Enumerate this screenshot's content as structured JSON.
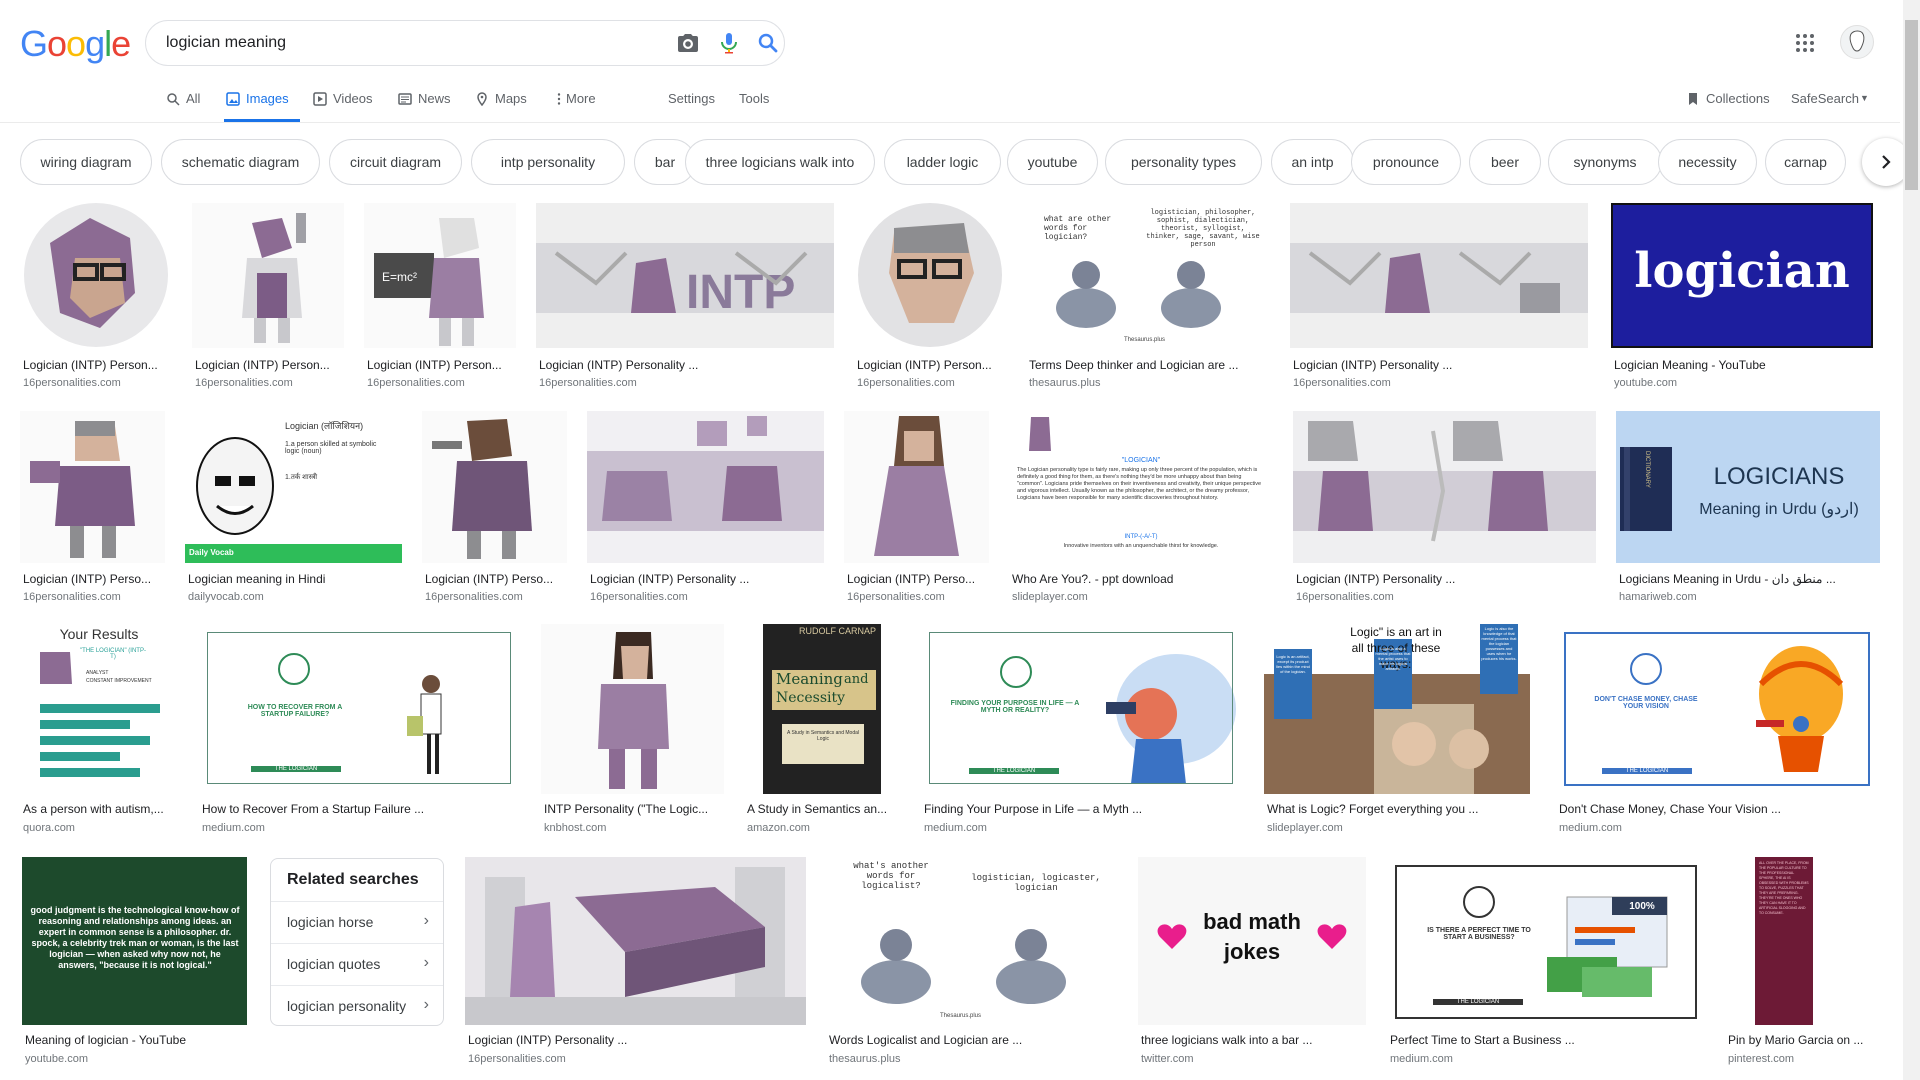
{
  "search": {
    "query": "logician meaning"
  },
  "logo": {
    "letters": [
      "G",
      "o",
      "o",
      "g",
      "l",
      "e"
    ],
    "colors": [
      "#4285F4",
      "#EA4335",
      "#FBBC05",
      "#4285F4",
      "#34A853",
      "#EA4335"
    ]
  },
  "tabs": {
    "all": "All",
    "images": "Images",
    "videos": "Videos",
    "news": "News",
    "maps": "Maps",
    "more": "More",
    "settings": "Settings",
    "tools": "Tools",
    "collections": "Collections",
    "safesearch": "SafeSearch"
  },
  "accent": "#1a73e8",
  "chips": [
    "wiring diagram",
    "schematic diagram",
    "circuit diagram",
    "intp personality",
    "bar",
    "three logicians walk into",
    "ladder logic",
    "youtube",
    "personality types",
    "an intp",
    "pronounce",
    "beer",
    "synonyms",
    "necessity",
    "carnap"
  ],
  "results": {
    "r1": [
      {
        "title": "Logician (INTP) Person...",
        "domain": "16personalities.com"
      },
      {
        "title": "Logician (INTP) Person...",
        "domain": "16personalities.com"
      },
      {
        "title": "Logician (INTP) Person...",
        "domain": "16personalities.com"
      },
      {
        "title": "Logician (INTP) Personality ...",
        "domain": "16personalities.com"
      },
      {
        "title": "Logician (INTP) Person...",
        "domain": "16personalities.com"
      },
      {
        "title": "Terms Deep thinker and Logician are ...",
        "domain": "thesaurus.plus"
      },
      {
        "title": "Logician (INTP) Personality ...",
        "domain": "16personalities.com"
      },
      {
        "title": "Logician Meaning - YouTube",
        "domain": "youtube.com"
      }
    ],
    "r2": [
      {
        "title": "Logician (INTP) Perso...",
        "domain": "16personalities.com"
      },
      {
        "title": "Logician meaning in Hindi",
        "domain": "dailyvocab.com"
      },
      {
        "title": "Logician (INTP) Perso...",
        "domain": "16personalities.com"
      },
      {
        "title": "Logician (INTP) Personality ...",
        "domain": "16personalities.com"
      },
      {
        "title": "Logician (INTP) Perso...",
        "domain": "16personalities.com"
      },
      {
        "title": "Who Are You?. - ppt download",
        "domain": "slideplayer.com"
      },
      {
        "title": "Logician (INTP) Personality ...",
        "domain": "16personalities.com"
      },
      {
        "title": "Logicians Meaning in Urdu - منطق دان ...",
        "domain": "hamariweb.com"
      }
    ],
    "r3": [
      {
        "title": "As a person with autism,...",
        "domain": "quora.com"
      },
      {
        "title": "How to Recover From a Startup Failure ...",
        "domain": "medium.com"
      },
      {
        "title": "INTP Personality (\"The Logic...",
        "domain": "knbhost.com"
      },
      {
        "title": "A Study in Semantics an...",
        "domain": "amazon.com"
      },
      {
        "title": "Finding Your Purpose in Life — a Myth ...",
        "domain": "medium.com"
      },
      {
        "title": "What is Logic? Forget everything you ...",
        "domain": "slideplayer.com"
      },
      {
        "title": "Don't Chase Money, Chase Your Vision ...",
        "domain": "medium.com"
      }
    ],
    "r4": [
      {
        "title": "Meaning of logician - YouTube",
        "domain": "youtube.com"
      },
      {
        "title": "Logician (INTP) Personality ...",
        "domain": "16personalities.com"
      },
      {
        "title": "Words Logicalist and Logician are ...",
        "domain": "thesaurus.plus"
      },
      {
        "title": "three logicians walk into a bar ...",
        "domain": "twitter.com"
      },
      {
        "title": "Perfect Time to Start a Business ...",
        "domain": "medium.com"
      },
      {
        "title": "Pin by Mario Garcia on ...",
        "domain": "pinterest.com"
      }
    ]
  },
  "thumbs": {
    "pigeons_q": "what are other words for logician?",
    "pigeons_a": "logistician, philosopher, sophist, dialectician, theorist, syllogist, thinker, sage, savant, wise person",
    "pigeons_src": "Thesaurus.plus",
    "logician_word": "logician",
    "hindi_head": "Logician (लॉजिशियन)",
    "hindi_def1": "1.a person skilled at symbolic logic (noun)",
    "hindi_def2": "1.तर्क शास्त्री",
    "daily": "Daily Vocab",
    "urdu_title": "LOGICIANS",
    "urdu_sub": "Meaning in Urdu (اردو)",
    "dict": "DICTIONARY",
    "ppt_head": "\"LOGICIAN\"",
    "ppt_body": "The Logician personality type is fairly rare, making up only three percent of the population, which is definitely a good thing for them, as there's nothing they'd be more unhappy about than being \"common\". Logicians pride themselves on their inventiveness and creativity, their unique perspective and vigorous intellect. Usually known as the philosopher, the architect, or the dreamy professor, Logicians have been responsible for many scientific discoveries throughout history.",
    "ppt_intp": "INTP-(-A/-T)",
    "ppt_foot": "Innovative inventors with an unquenchable thirst for knowledge.",
    "results_head": "Your Results",
    "results_sub": "\"THE LOGICIAN\" (INTP-T)",
    "results_b1": "ANALYST",
    "results_b2": "CONSTANT IMPROVEMENT",
    "recover": "HOW TO RECOVER FROM A STARTUP FAILURE?",
    "the_logician": "THE LOGICIAN",
    "book_author": "RUDOLF CARNAP",
    "book_t1": "Meaning",
    "book_and": "and",
    "book_t2": "Necessity",
    "book_sub": "A Study in Semantics and Modal Logic",
    "purpose": "FINDING YOUR PURPOSE IN LIFE — A MYTH OR REALITY?",
    "logic_top": "Logic\" is an art in all three of these ways:",
    "logic_b1": "Logic is an artifact, except its product lies within the mind of the logician.",
    "logic_b2": "Logic is also a mental process that the artist uses to make his logical artifacts.",
    "logic_b3": "Logic is also the knowledge of that mental process that the logician possesses and uses when he produces his works.",
    "chase": "DON'T CHASE MONEY, CHASE YOUR VISION",
    "quote": "good judgment is the technological know-how of reasoning and relationships among ideas. an expert in common sense is a philosopher. dr. spock, a celebrity trek man or woman, is the last logician — when asked why now not, he answers, \"because it is not logical.\"",
    "pig2_q": "what's another words for logicalist?",
    "pig2_a": "logistician, logicaster, logician",
    "badmath": "bad math jokes",
    "perfect": "IS THERE A PERFECT TIME TO START A BUSINESS?",
    "pct": "100%",
    "pin_text": "ALL OVER THE PLACE, FROM THE POPULAR CULTURE TO THE PROFESSIONAL SPHERE, THE AI IS OBSESSED WITH PROBLEMS TO SOLVE, PUZZLES THAT THEY ARE PREPARING. THEY'RE THE ONES WHO THEY CAN HAVE IT TO ARTIFICIAL SLOGGING AND TO CONSUME."
  },
  "related": {
    "heading": "Related searches",
    "items": [
      "logician horse",
      "logician quotes",
      "logician personality"
    ],
    "chevron": "›"
  }
}
